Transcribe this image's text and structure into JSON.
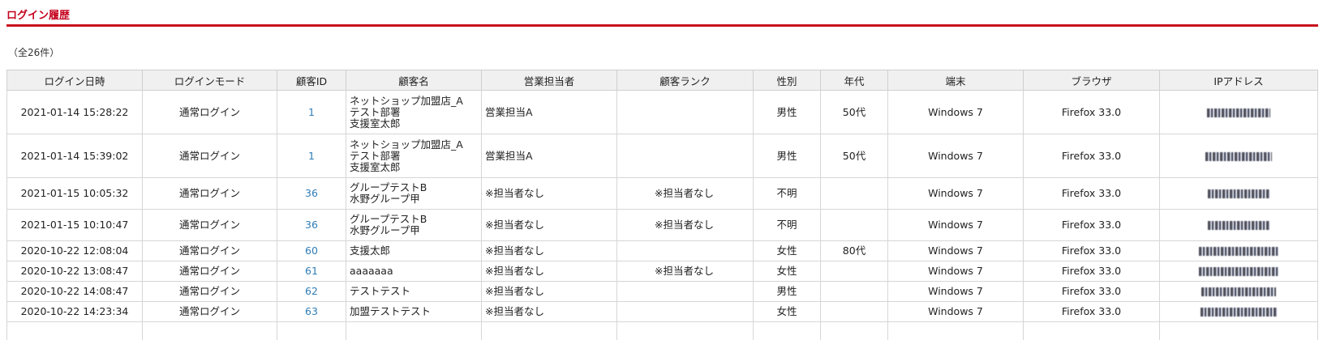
{
  "page": {
    "title": "ログイン履歴",
    "count": "（全26件）"
  },
  "table": {
    "headers": [
      "ログイン日時",
      "ログインモード",
      "顧客ID",
      "顧客名",
      "営業担当者",
      "顧客ランク",
      "性別",
      "年代",
      "端末",
      "ブラウザ",
      "IPアドレス"
    ],
    "rows": [
      {
        "datetime": "2021-01-14 15:28:22",
        "mode": "通常ログイン",
        "customer_id": "1",
        "name_lines": [
          "ネットショップ加盟店_A",
          "テスト部署",
          "支援室太郎"
        ],
        "sales_rep": "営業担当A",
        "rank": "",
        "gender": "男性",
        "age": "50代",
        "device": "Windows 7",
        "browser": "Firefox 33.0",
        "ip_mask_width": 78
      },
      {
        "datetime": "2021-01-14 15:39:02",
        "mode": "通常ログイン",
        "customer_id": "1",
        "name_lines": [
          "ネットショップ加盟店_A",
          "テスト部署",
          "支援室太郎"
        ],
        "sales_rep": "営業担当A",
        "rank": "",
        "gender": "男性",
        "age": "50代",
        "device": "Windows 7",
        "browser": "Firefox 33.0",
        "ip_mask_width": 82
      },
      {
        "datetime": "2021-01-15 10:05:32",
        "mode": "通常ログイン",
        "customer_id": "36",
        "name_lines": [
          "グループテストB",
          "水野グループ甲"
        ],
        "sales_rep": "※担当者なし",
        "rank": "※担当者なし",
        "gender": "不明",
        "age": "",
        "device": "Windows 7",
        "browser": "Firefox 33.0",
        "ip_mask_width": 76
      },
      {
        "datetime": "2021-01-15 10:10:47",
        "mode": "通常ログイン",
        "customer_id": "36",
        "name_lines": [
          "グループテストB",
          "水野グループ甲"
        ],
        "sales_rep": "※担当者なし",
        "rank": "※担当者なし",
        "gender": "不明",
        "age": "",
        "device": "Windows 7",
        "browser": "Firefox 33.0",
        "ip_mask_width": 76
      },
      {
        "datetime": "2020-10-22 12:08:04",
        "mode": "通常ログイン",
        "customer_id": "60",
        "name_lines": [
          "支援太郎"
        ],
        "sales_rep": "※担当者なし",
        "rank": "",
        "gender": "女性",
        "age": "80代",
        "device": "Windows 7",
        "browser": "Firefox 33.0",
        "ip_mask_width": 98
      },
      {
        "datetime": "2020-10-22 13:08:47",
        "mode": "通常ログイン",
        "customer_id": "61",
        "name_lines": [
          "aaaaaaa"
        ],
        "sales_rep": "※担当者なし",
        "rank": "※担当者なし",
        "gender": "女性",
        "age": "",
        "device": "Windows 7",
        "browser": "Firefox 33.0",
        "ip_mask_width": 98
      },
      {
        "datetime": "2020-10-22 14:08:47",
        "mode": "通常ログイン",
        "customer_id": "62",
        "name_lines": [
          "テストテスト"
        ],
        "sales_rep": "※担当者なし",
        "rank": "",
        "gender": "男性",
        "age": "",
        "device": "Windows 7",
        "browser": "Firefox 33.0",
        "ip_mask_width": 92
      },
      {
        "datetime": "2020-10-22 14:23:34",
        "mode": "通常ログイン",
        "customer_id": "63",
        "name_lines": [
          "加盟テストテスト"
        ],
        "sales_rep": "※担当者なし",
        "rank": "",
        "gender": "女性",
        "age": "",
        "device": "Windows 7",
        "browser": "Firefox 33.0",
        "ip_mask_width": 94
      }
    ]
  },
  "colors": {
    "title_red": "#c4001c",
    "rule_red": "#c8101e",
    "link_blue": "#2f7db6",
    "header_bg": "#f0f0f0"
  }
}
